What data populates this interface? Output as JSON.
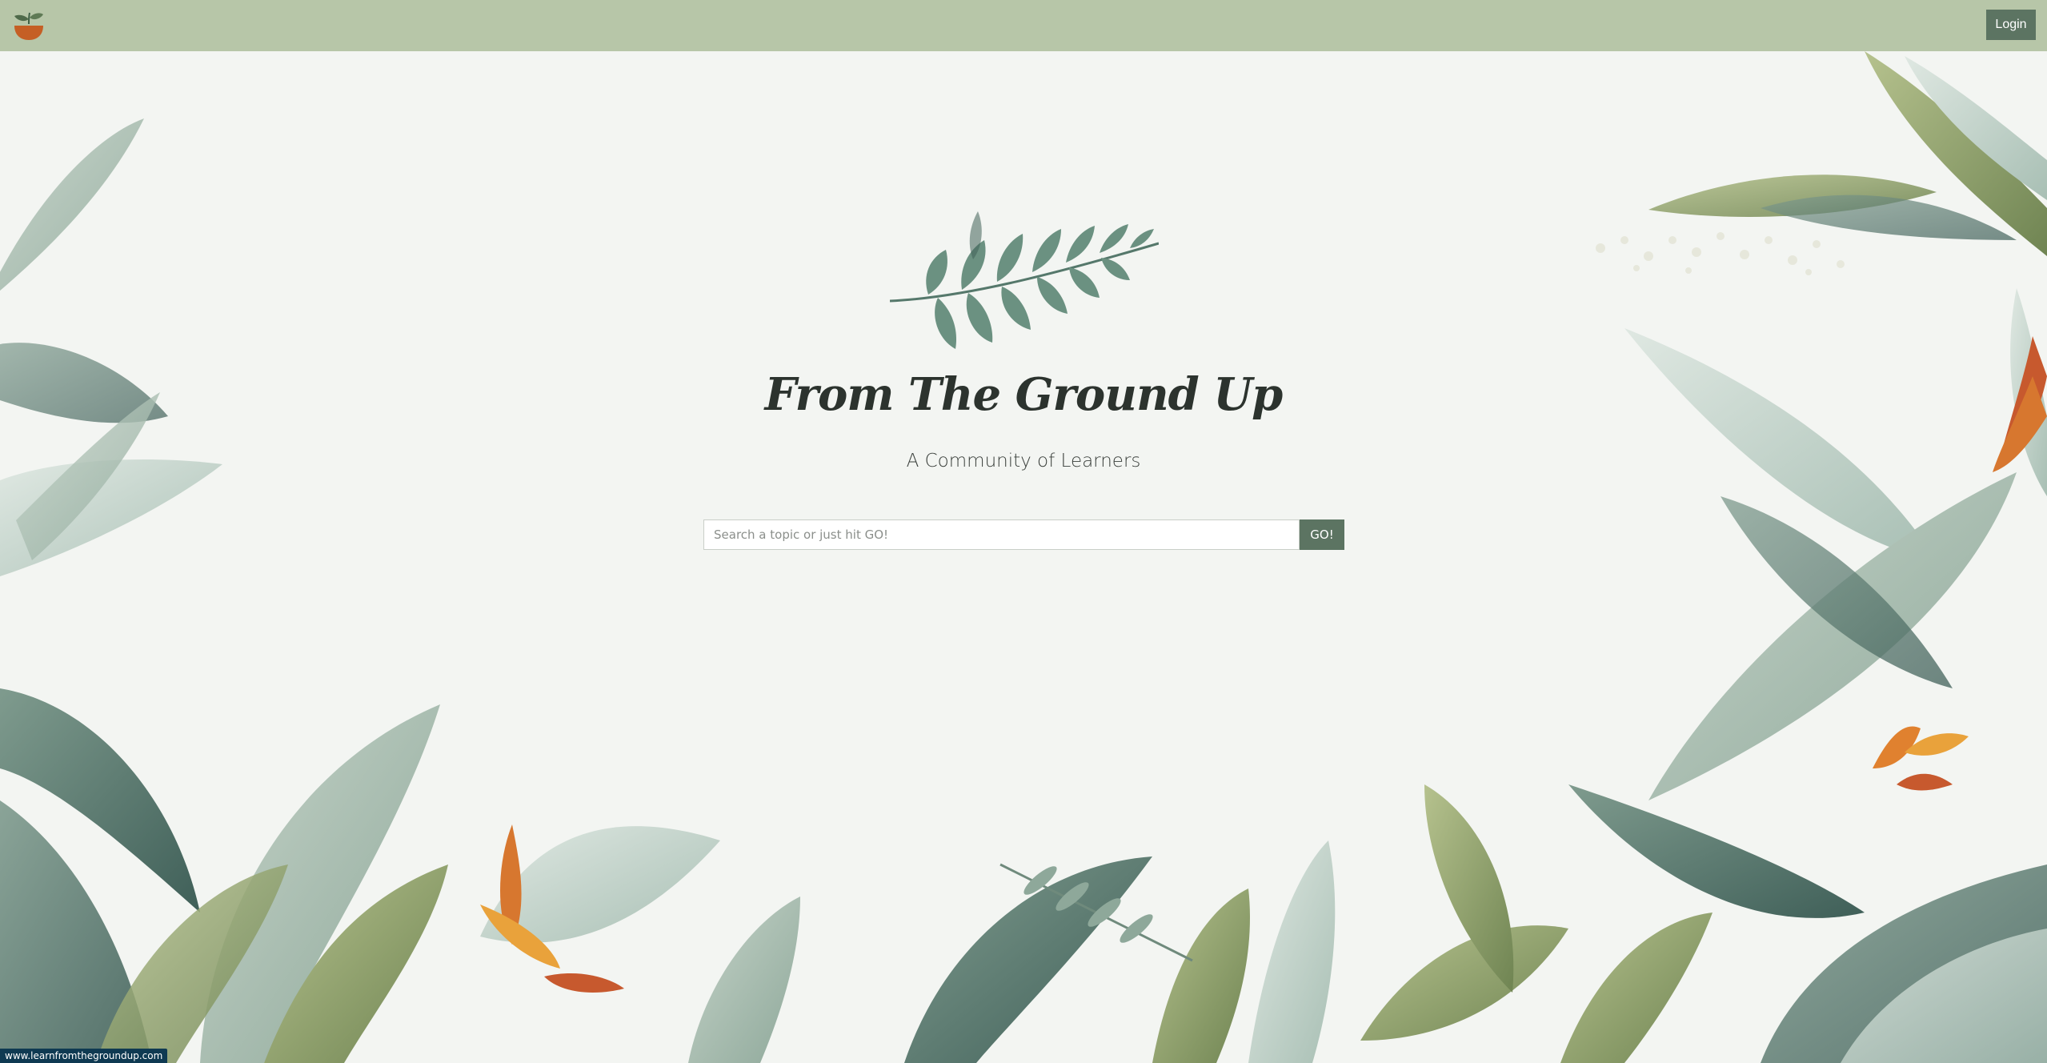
{
  "navbar": {
    "logo_icon": "seedling-bowl-icon",
    "login_label": "Login",
    "background_color": "#b7c6a8",
    "button_color": "#5c7462"
  },
  "hero": {
    "emblem_icon": "leaf-sprig-icon",
    "title": "From The Ground Up",
    "tagline": "A Community of Learners"
  },
  "search": {
    "placeholder": "Search a topic or just hit GO!",
    "value": "",
    "submit_label": "GO!"
  },
  "decoration": {
    "background_icon": "tropical-foliage-illustration"
  },
  "status_bar": {
    "url": "www.learnfromthegroundup.com"
  }
}
